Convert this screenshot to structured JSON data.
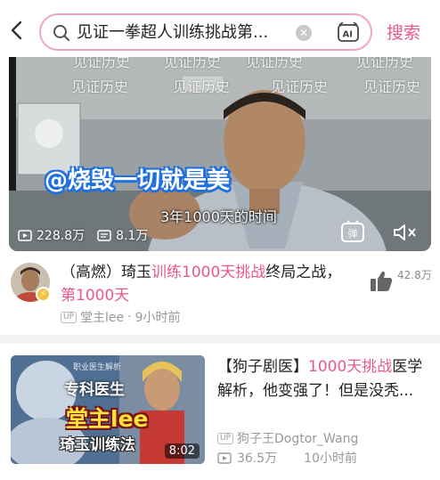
{
  "search": {
    "query": "见证一拳超人训练挑战第...",
    "button_label": "搜索"
  },
  "video": {
    "watermark": "见证历史",
    "caption_main": "@烧毁一切就是美",
    "caption_sub": "3年1000天的时间",
    "views": "228.8万",
    "danmaku_count": "8.1万",
    "danmaku_label": "弹"
  },
  "result1": {
    "title_parts": [
      "（高燃）琦玉",
      "训练1000天挑战",
      "终局之战，",
      "第1000天"
    ],
    "likes": "42.8万",
    "author": "堂主lee",
    "time": "9小时前",
    "up_label": "UP"
  },
  "result2": {
    "title_parts": [
      "【狗子剧医】",
      "1000天挑战",
      "医学解析，他变强了！但是没秃..."
    ],
    "thumb_small": "职业医生解析",
    "thumb_line1": "专科医生",
    "thumb_line2": "堂主lee",
    "thumb_line3": "琦玉训练法",
    "duration": "8:02",
    "author": "狗子王Dogtor_Wang",
    "views": "36.5万",
    "time": "10小时前",
    "up_label": "UP"
  }
}
